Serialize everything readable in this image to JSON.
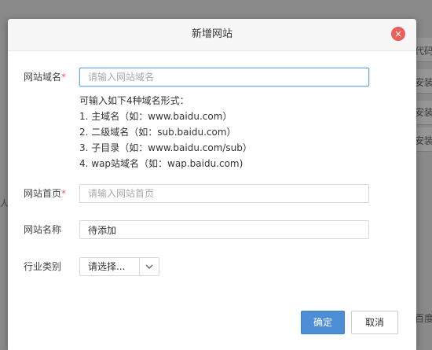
{
  "background": {
    "right_fragments": [
      "代码",
      "安装",
      "安装",
      "安装"
    ],
    "left_fragment": "人",
    "bottom_right_fragment": "百度"
  },
  "modal": {
    "title": "新增网站",
    "close_glyph": "×"
  },
  "form": {
    "domain": {
      "label": "网站域名",
      "required_mark": "*",
      "placeholder": "请输入网站域名",
      "value": ""
    },
    "hints": [
      "可输入如下4种域名形式：",
      "1. 主域名（如：www.baidu.com）",
      "2. 二级域名（如：sub.baidu.com）",
      "3. 子目录（如：www.baidu.com/sub）",
      "4. wap站域名（如：wap.baidu.com)"
    ],
    "homepage": {
      "label": "网站首页",
      "required_mark": "*",
      "placeholder": "请输入网站首页",
      "value": ""
    },
    "site_name": {
      "label": "网站名称",
      "value": "待添加"
    },
    "industry": {
      "label": "行业类别",
      "selected": "请选择..."
    }
  },
  "buttons": {
    "confirm": "确定",
    "cancel": "取消"
  },
  "colors": {
    "primary": "#4d8fd6",
    "close": "#e9605a",
    "required": "#e9605a",
    "focus_border": "#6aa6d8"
  }
}
